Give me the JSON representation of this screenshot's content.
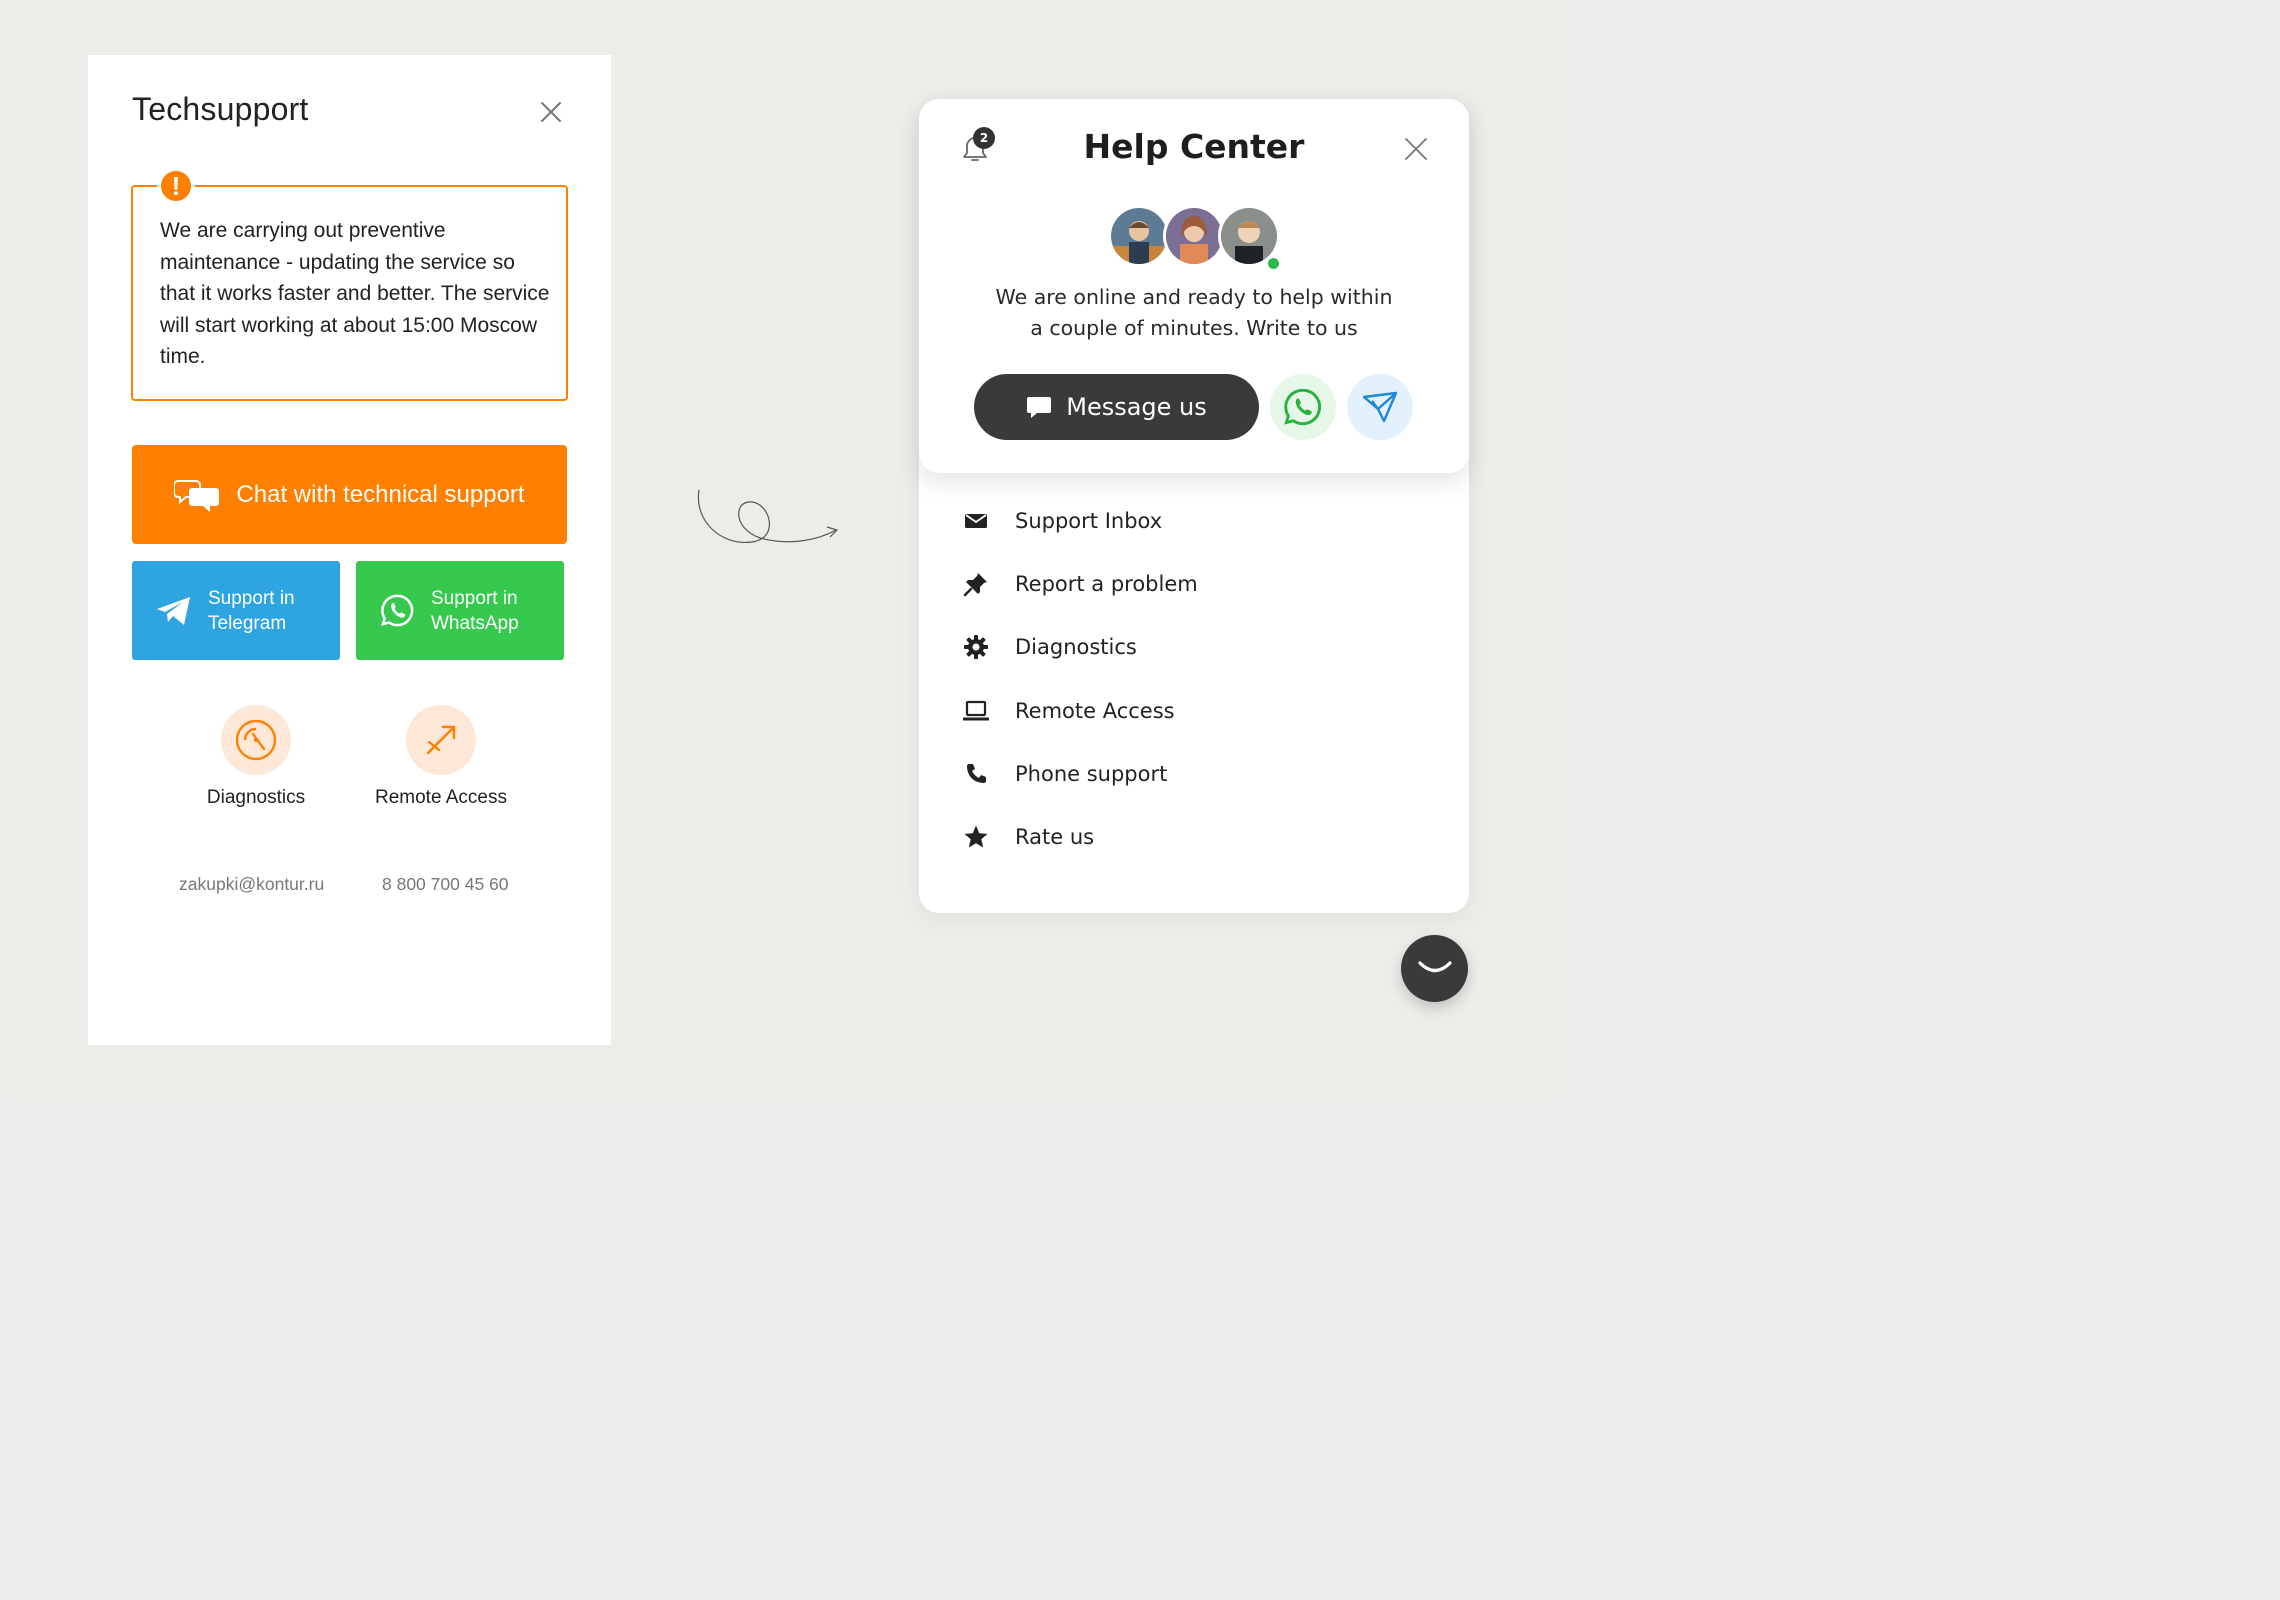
{
  "techsupport": {
    "title": "Techsupport",
    "notice_badge": "!",
    "notice_text": "We are carrying out preventive maintenance - updating the service so that it works faster and better. The service will start working at about 15:00 Moscow time.",
    "chat_button": "Chat with technical support",
    "telegram_button": [
      "Support in",
      "Telegram"
    ],
    "whatsapp_button": [
      "Support in",
      "WhatsApp"
    ],
    "tools": [
      {
        "label": "Diagnostics",
        "icon": "diagnostics-icon"
      },
      {
        "label": "Remote Access",
        "icon": "remote-access-icon"
      }
    ],
    "email": "zakupki@kontur.ru",
    "phone": "8 800 700 45 60",
    "colors": {
      "accent": "#ff8000",
      "telegram": "#2ea5e1",
      "whatsapp": "#37c84e"
    }
  },
  "help_center": {
    "title": "Help Center",
    "notification_count": "2",
    "message": [
      "We are online and ready to help within",
      "a couple of minutes. Write to us"
    ],
    "message_button": "Message us",
    "menu": [
      {
        "label": "Support Inbox",
        "icon": "envelope-icon"
      },
      {
        "label": "Report a problem",
        "icon": "pin-icon"
      },
      {
        "label": "Diagnostics",
        "icon": "gear-icon"
      },
      {
        "label": "Remote Access",
        "icon": "laptop-icon"
      },
      {
        "label": "Phone support",
        "icon": "phone-icon"
      },
      {
        "label": "Rate us",
        "icon": "star-icon"
      }
    ],
    "colors": {
      "dark": "#3a3a3a",
      "online": "#2db84c"
    }
  }
}
